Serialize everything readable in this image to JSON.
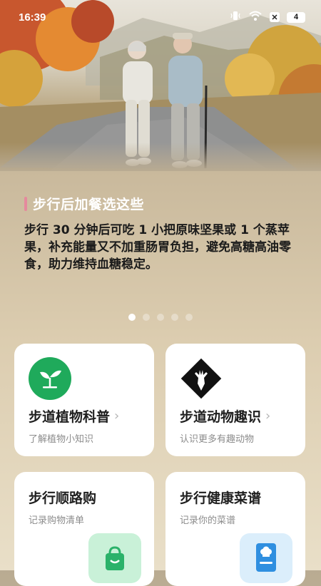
{
  "status_bar": {
    "time": "16:39",
    "battery": "4"
  },
  "article": {
    "title": "步行后加餐选这些",
    "body": "步行 30 分钟后可吃 1 小把原味坚果或 1 个蒸苹果，补充能量又不加重肠胃负担，避免高糖高油零食，助力维持血糖稳定。"
  },
  "pagination": {
    "count": 5,
    "active": 0
  },
  "cards": {
    "plants": {
      "title": "步道植物科普",
      "subtitle": "了解植物小知识"
    },
    "animals": {
      "title": "步道动物趣识",
      "subtitle": "认识更多有趣动物"
    },
    "shopping": {
      "title": "步行顺路购",
      "subtitle": "记录购物清单"
    },
    "recipes": {
      "title": "步行健康菜谱",
      "subtitle": "记录你的菜谱"
    }
  },
  "colors": {
    "accent": "#e58a9d",
    "plant_icon": "#1faa5b",
    "shopping_tile": "#c9f1d8",
    "recipe_tile": "#dbeefb"
  },
  "icons": [
    "sprout-icon",
    "deer-icon",
    "shopping-bag-icon",
    "chef-card-icon",
    "wifi-icon",
    "vibrate-icon",
    "battery-icon"
  ]
}
